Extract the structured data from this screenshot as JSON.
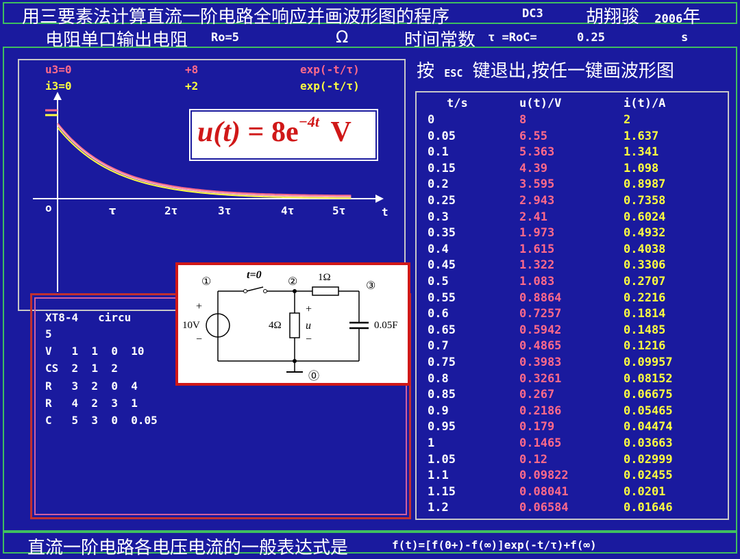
{
  "header": {
    "title": "用三要素法计算直流一阶电路全响应并画波形图的程序",
    "code": "DC3",
    "author": "胡翔骏",
    "year_num": "2006",
    "year_char": "年"
  },
  "line2": {
    "label1": "电阻单口输出电阻",
    "ro": "Ro=5",
    "omega": "Ω",
    "label2": "时间常数",
    "tau_expr": "τ =RoC=",
    "tau_value": "0.25",
    "unit": "s"
  },
  "prompt": {
    "key_label": "按",
    "esc": "ESC",
    "text": "键退出,按任一键画波形图"
  },
  "plot": {
    "legend": [
      {
        "name": "u3=0",
        "coef": "+8",
        "expr": "exp(-t/τ)",
        "color": "#ff6a8a"
      },
      {
        "name": "i3=0",
        "coef": "+2",
        "expr": "exp(-t/τ)",
        "color": "#ffff40"
      }
    ],
    "axis_t": "t",
    "origin": "o",
    "ticks": [
      "τ",
      "2τ",
      "3τ",
      "4τ",
      "5τ"
    ]
  },
  "formula": {
    "lhs": "u(t)",
    "eq": "=",
    "coef": "8e",
    "exp": "−4t",
    "unit": "V"
  },
  "netlist": {
    "lines": [
      "XT8-4   circu",
      "5",
      "V   1  1  0  10",
      "CS  2  1  2",
      "R   3  2  0  4",
      "R   4  2  3  1",
      "C   5  3  0  0.05"
    ]
  },
  "circuit": {
    "node1": "①",
    "node2": "②",
    "node3": "③",
    "node0": "⓪",
    "switch": "t=0",
    "r1": "1Ω",
    "r2": "4Ω",
    "source": "10V",
    "cap": "0.05F",
    "u_label": "u",
    "plus": "+",
    "minus": "−"
  },
  "table": {
    "headers": [
      "t/s",
      "u(t)/V",
      "i(t)/A"
    ],
    "rows": [
      [
        "0",
        "8",
        "2"
      ],
      [
        "0.05",
        "6.55",
        "1.637"
      ],
      [
        "0.1",
        "5.363",
        "1.341"
      ],
      [
        "0.15",
        "4.39",
        "1.098"
      ],
      [
        "0.2",
        "3.595",
        "0.8987"
      ],
      [
        "0.25",
        "2.943",
        "0.7358"
      ],
      [
        "0.3",
        "2.41",
        "0.6024"
      ],
      [
        "0.35",
        "1.973",
        "0.4932"
      ],
      [
        "0.4",
        "1.615",
        "0.4038"
      ],
      [
        "0.45",
        "1.322",
        "0.3306"
      ],
      [
        "0.5",
        "1.083",
        "0.2707"
      ],
      [
        "0.55",
        "0.8864",
        "0.2216"
      ],
      [
        "0.6",
        "0.7257",
        "0.1814"
      ],
      [
        "0.65",
        "0.5942",
        "0.1485"
      ],
      [
        "0.7",
        "0.4865",
        "0.1216"
      ],
      [
        "0.75",
        "0.3983",
        "0.09957"
      ],
      [
        "0.8",
        "0.3261",
        "0.08152"
      ],
      [
        "0.85",
        "0.267",
        "0.06675"
      ],
      [
        "0.9",
        "0.2186",
        "0.05465"
      ],
      [
        "0.95",
        "0.179",
        "0.04474"
      ],
      [
        "1",
        "0.1465",
        "0.03663"
      ],
      [
        "1.05",
        "0.12",
        "0.02999"
      ],
      [
        "1.1",
        "0.09822",
        "0.02455"
      ],
      [
        "1.15",
        "0.08041",
        "0.0201"
      ],
      [
        "1.2",
        "0.06584",
        "0.01646"
      ]
    ]
  },
  "footer": {
    "label": "直流一阶电路各电压电流的一般表达式是",
    "formula": "f(t)=[f(0+)-f(∞)]exp(-t/τ)+f(∞)"
  },
  "colors": {
    "background": "#1a1a9e",
    "frame": "#3fbf5f",
    "u_curve": "#ff6a8a",
    "i_curve": "#ffff40"
  }
}
